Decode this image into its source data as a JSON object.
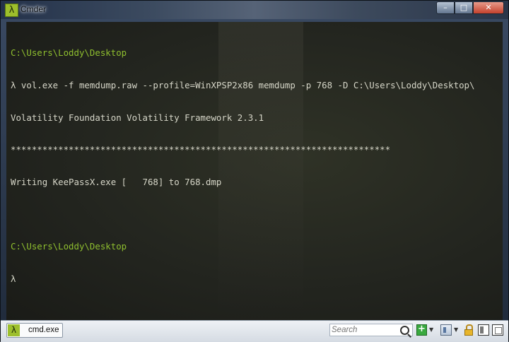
{
  "window": {
    "title": "Cmder",
    "title_icon_glyph": "λ",
    "buttons": {
      "minimize": "–",
      "maximize": "□",
      "close": "✕"
    }
  },
  "console": {
    "lines": [
      {
        "kind": "prompt",
        "text": "C:\\Users\\Loddy\\Desktop"
      },
      {
        "kind": "out",
        "text": "λ vol.exe -f memdump.raw --profile=WinXPSP2x86 memdump -p 768 -D C:\\Users\\Loddy\\Desktop\\"
      },
      {
        "kind": "out",
        "text": "Volatility Foundation Volatility Framework 2.3.1"
      },
      {
        "kind": "out",
        "text": "************************************************************************"
      },
      {
        "kind": "out",
        "text": "Writing KeePassX.exe [   768] to 768.dmp"
      },
      {
        "kind": "out",
        "text": ""
      },
      {
        "kind": "prompt",
        "text": "C:\\Users\\Loddy\\Desktop"
      },
      {
        "kind": "out",
        "text": "λ"
      }
    ]
  },
  "statusbar": {
    "tab_label": "cmd.exe",
    "tab_icon_glyph": "λ",
    "search_placeholder": "Search",
    "add_glyph": "+",
    "dropdown_glyph": "▼"
  },
  "colors": {
    "prompt": "#8fbf2f",
    "output": "#d6d6c8",
    "accent": "#9dbf2c"
  }
}
